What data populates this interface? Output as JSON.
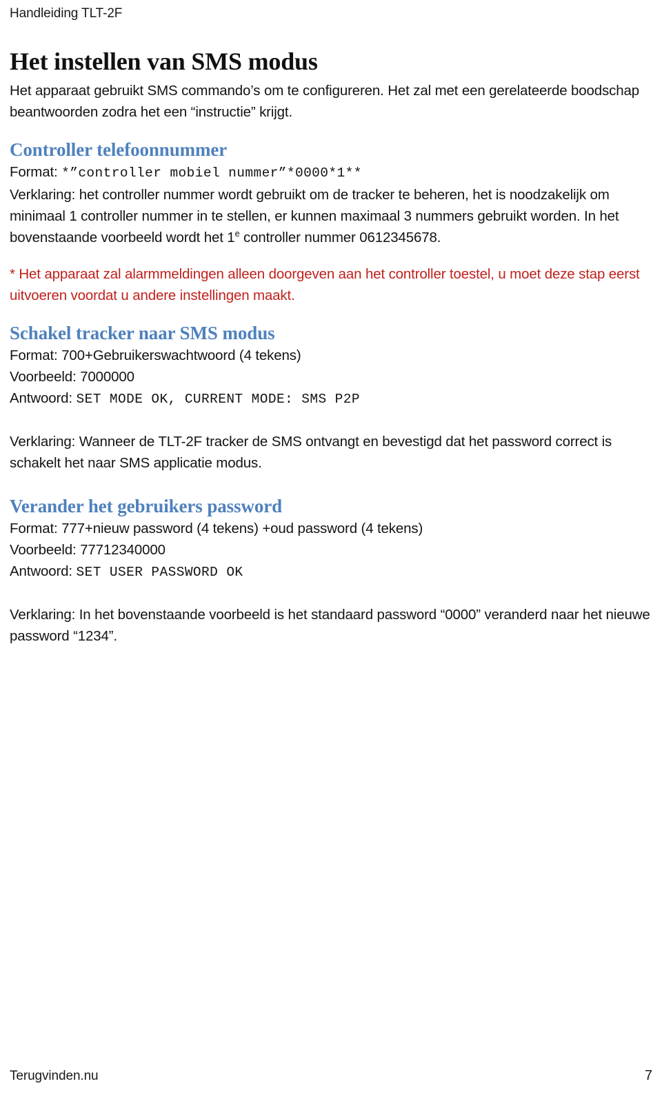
{
  "document": {
    "running_header": "Handleiding TLT-2F",
    "title": "Het instellen van SMS modus",
    "intro": "Het apparaat gebruikt SMS commando’s om te configureren. Het zal met een gerelateerde boodschap beantwoorden zodra het een “instructie” krijgt."
  },
  "colors": {
    "heading_blue": "#4F81BD",
    "warning_red": "#C0211D",
    "body_black": "#141414",
    "page_background": "#FFFFFF"
  },
  "sections": [
    {
      "heading": "Controller telefoonnummer",
      "format_label": "Format: ",
      "format_code": "*”controller mobiel nummer”*0000*1**",
      "explanation_pre": "Verklaring: het controller nummer wordt gebruikt om de tracker te beheren, het is noodzakelijk om minimaal 1 controller nummer in te stellen, er kunnen maximaal 3 nummers gebruikt worden. In het bovenstaande voorbeeld wordt het 1",
      "explanation_sup": "e",
      "explanation_post": " controller nummer 0612345678."
    },
    {
      "heading": "Schakel tracker naar SMS modus",
      "format_label": "Format: ",
      "format_value": "700+Gebruikerswachtwoord (4 tekens)",
      "example_label": "Voorbeeld: ",
      "example_value": "7000000",
      "answer_label": "Antwoord: ",
      "answer_code": "SET MODE OK, CURRENT MODE: SMS P2P",
      "explanation": "Verklaring: Wanneer de TLT-2F tracker de SMS ontvangt en bevestigd dat het password correct is schakelt het naar SMS applicatie modus."
    },
    {
      "heading": "Verander het gebruikers password",
      "format_label": "Format: ",
      "format_value": "777+nieuw password (4 tekens) +oud password (4 tekens)",
      "example_label": "Voorbeeld: ",
      "example_value": "77712340000",
      "answer_label": "Antwoord: ",
      "answer_code": "SET USER PASSWORD OK",
      "explanation": "Verklaring: In het bovenstaande voorbeeld is het standaard password “0000” veranderd naar het nieuwe password “1234”."
    }
  ],
  "warning": {
    "text": "* Het apparaat zal alarmmeldingen alleen doorgeven aan het controller toestel, u moet deze stap eerst uitvoeren voordat u andere instellingen maakt."
  },
  "footer": {
    "left": "Terugvinden.nu",
    "page_number": "7"
  }
}
